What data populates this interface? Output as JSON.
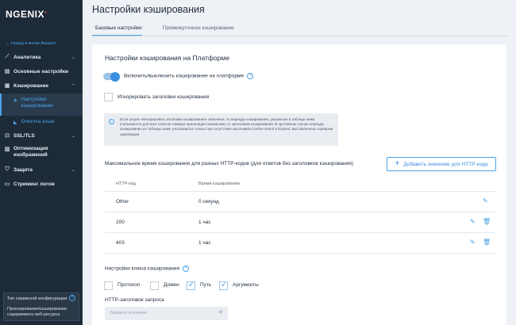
{
  "sidebar": {
    "logo": "NGENIX",
    "back_link": "← Назад в меню Аккаунт",
    "items": [
      {
        "label": "Аналитика",
        "icon": "chart-icon"
      },
      {
        "label": "Основные настройки",
        "icon": "settings-icon"
      },
      {
        "label": "Кэширование",
        "icon": "cache-icon"
      },
      {
        "label": "SSL/TLS",
        "icon": "lock-icon"
      },
      {
        "label": "Оптимизация изображений",
        "icon": "image-icon"
      },
      {
        "label": "Защита",
        "icon": "shield-icon"
      },
      {
        "label": "Стриминг логов",
        "icon": "stream-icon"
      }
    ],
    "sub_items": [
      {
        "label": "Настройки кэширования",
        "icon": "gear-icon"
      },
      {
        "label": "Очистка кэша",
        "icon": "brush-icon"
      }
    ],
    "config_box": {
      "title": "Тип сервисной конфигурации:",
      "value": "Проксирование/кэширование содержимого веб-ресурса"
    }
  },
  "page": {
    "title": "Настройки кэширования",
    "tabs": [
      {
        "label": "Базовые настройки",
        "active": true
      },
      {
        "label": "Промежуточное кэширование",
        "active": false
      }
    ]
  },
  "card": {
    "title": "Настройки кэширования на Платформе",
    "toggle_label": "Включить/выключить кэширование на платформе",
    "toggle_on": true,
    "ignore_headers_label": "Игнорировать заголовки кэширования",
    "info_text": "Если опция «Игнорировать заголовки кэширования» включена, то периоды кэширования, указанные в таблице ниже, учитываются для всех ответов сервера оригинации независимо от заголовков кэширования. В противном случае периоды кэширования из таблицы ниже учитываются только при отсутствии заголовков Cache-control и Expires, выставленных сервером оригинации",
    "max_time_label": "Максимальное время кэширования для разных HTTP-кодов (для ответов без заголовков кэширования)",
    "add_button_label": "Добавить значение для HTTP-кода",
    "table": {
      "headers": [
        "HTTP-код",
        "Время кэширования"
      ],
      "rows": [
        {
          "code": "Other",
          "time": "0 секунд"
        },
        {
          "code": "200",
          "time": "1 час"
        },
        {
          "code": "403",
          "time": "1 час"
        }
      ]
    },
    "cache_key_label": "Настройки ключа кэширования",
    "cache_key_options": [
      {
        "label": "Протокол",
        "checked": false
      },
      {
        "label": "Домен",
        "checked": false
      },
      {
        "label": "Путь",
        "checked": true
      },
      {
        "label": "Аргументы",
        "checked": true
      }
    ],
    "http_header_label": "HTTP-заголовок запроса",
    "http_header_placeholder": "Введите значение"
  }
}
